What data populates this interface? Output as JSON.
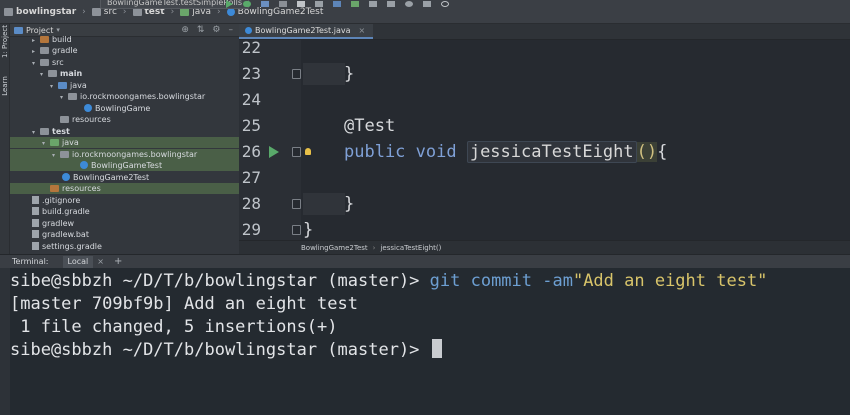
{
  "navbar": {
    "crumbs": [
      "bowlingstar",
      "src",
      "test",
      "java",
      "BowlingGame2Test"
    ],
    "run_config": "BowlingGameTest.testSimpleRolls"
  },
  "side_strip": {
    "project_label": "1: Project",
    "learn_label": "Learn"
  },
  "project_panel": {
    "title": "Project",
    "tree": [
      {
        "label": "build",
        "icon": "folder-orange-icon"
      },
      {
        "label": "gradle",
        "icon": "folder-icon"
      },
      {
        "label": "src",
        "icon": "folder-icon"
      },
      {
        "label": "main",
        "icon": "folder-icon"
      },
      {
        "label": "java",
        "icon": "source-folder-icon"
      },
      {
        "label": "io.rockmoongames.bowlingstar",
        "icon": "package-icon"
      },
      {
        "label": "BowlingGame",
        "icon": "class-icon"
      },
      {
        "label": "resources",
        "icon": "folder-icon"
      },
      {
        "label": "test",
        "icon": "folder-icon"
      },
      {
        "label": "java",
        "icon": "test-folder-icon"
      },
      {
        "label": "io.rockmoongames.bowlingstar",
        "icon": "package-icon"
      },
      {
        "label": "BowlingGameTest",
        "icon": "test-class-icon"
      },
      {
        "label": "BowlingGame2Test",
        "icon": "test-class-icon"
      },
      {
        "label": "resources",
        "icon": "folder-icon"
      },
      {
        "label": ".gitignore",
        "icon": "file-icon"
      },
      {
        "label": "build.gradle",
        "icon": "gradle-icon"
      },
      {
        "label": "gradlew",
        "icon": "file-icon"
      },
      {
        "label": "gradlew.bat",
        "icon": "file-icon"
      },
      {
        "label": "settings.gradle",
        "icon": "gradle-icon"
      }
    ]
  },
  "editor": {
    "tab": "BowlingGame2Test.java",
    "lines": [
      {
        "num": "22",
        "code": ""
      },
      {
        "num": "23",
        "code": "}"
      },
      {
        "num": "24",
        "code": ""
      },
      {
        "num": "25",
        "annotation": "@Test"
      },
      {
        "num": "26",
        "kw": "public void ",
        "fn": "jessicaTestEight",
        "paren": "()",
        "tail": "{"
      },
      {
        "num": "27",
        "code": ""
      },
      {
        "num": "28",
        "code": "}"
      },
      {
        "num": "29",
        "code": "}"
      }
    ],
    "breadcrumbs": [
      "BowlingGame2Test",
      "jessicaTestEight()"
    ]
  },
  "terminal": {
    "label": "Terminal:",
    "tab": "Local",
    "lines": [
      {
        "user": "sibe@sbbzh",
        "path": " ~/D/T/b/bowlingstar",
        "branch": " (master)> ",
        "cmd": "git commit -am",
        "str": "\"Add an eight test\""
      },
      {
        "text": "[master 709bf9b] Add an eight test"
      },
      {
        "text": " 1 file changed, 5 insertions(+)"
      },
      {
        "user": "sibe@sbbzh",
        "path": " ~/D/T/b/bowlingstar",
        "branch": " (master)> "
      }
    ]
  },
  "colors": {
    "accent": "#5d85b8",
    "selection": "#4a5f47",
    "keyword": "#7fa0d6",
    "annotation": "#e6c07b",
    "string": "#d8c46a"
  }
}
